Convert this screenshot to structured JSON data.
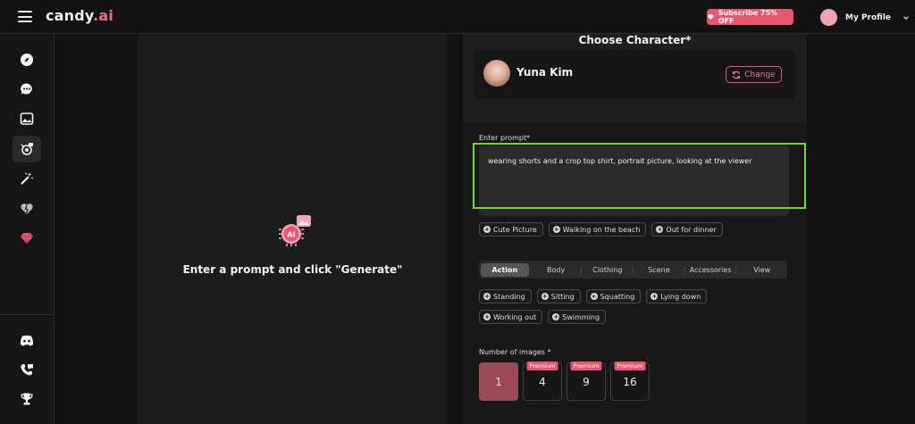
{
  "header": {
    "logo_main": "candy",
    "logo_accent": ".ai",
    "subscribe_label": "Subscribe 75% OFF",
    "profile_label": "My Profile"
  },
  "sidebar": {
    "items": [
      {
        "icon": "compass-icon"
      },
      {
        "icon": "chat-icon"
      },
      {
        "icon": "gallery-icon"
      },
      {
        "icon": "generate-image-icon"
      },
      {
        "icon": "magic-wand-icon"
      },
      {
        "icon": "heart-icon"
      },
      {
        "icon": "gem-icon"
      }
    ],
    "bottom_items": [
      {
        "icon": "discord-icon"
      },
      {
        "icon": "support-icon"
      },
      {
        "icon": "trophy-icon"
      }
    ]
  },
  "left_panel": {
    "generate_hint": "Enter a prompt and click \"Generate\""
  },
  "character": {
    "section_title": "Choose Character*",
    "name": "Yuna Kim",
    "change_label": "Change"
  },
  "prompt": {
    "label": "Enter prompt*",
    "value": "wearing shorts and a crop top shirt, portrait picture, looking at the viewer"
  },
  "suggestions": [
    "Cute Picture",
    "Walking on the beach",
    "Out for dinner"
  ],
  "tabs": [
    "Action",
    "Body",
    "Clothing",
    "Scene",
    "Accessories",
    "View"
  ],
  "actions": {
    "row1": [
      "Standing",
      "Sitting",
      "Squatting",
      "Lying down"
    ],
    "row2": [
      "Working out",
      "Swimming"
    ]
  },
  "images": {
    "label": "Number of images *",
    "options": [
      {
        "value": "1",
        "badge": ""
      },
      {
        "value": "4",
        "badge": "Premium"
      },
      {
        "value": "9",
        "badge": "Premium"
      },
      {
        "value": "16",
        "badge": "Premium"
      }
    ]
  },
  "colors": {
    "accent": "#e9566e",
    "highlight": "#6bdc2b",
    "selected": "#9c4a58"
  }
}
